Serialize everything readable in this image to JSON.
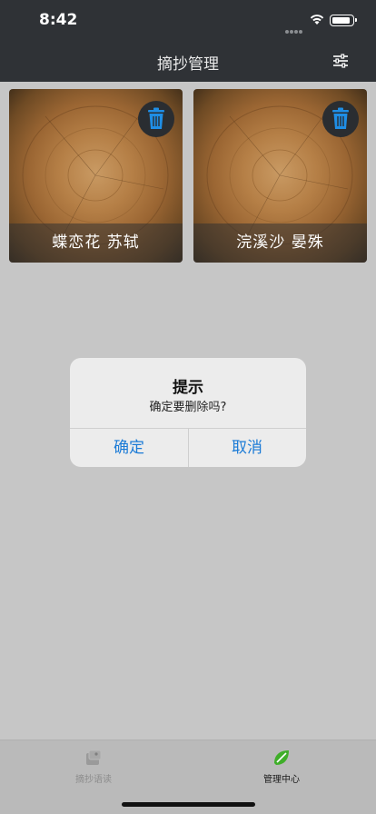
{
  "status_bar": {
    "time": "8:42"
  },
  "nav": {
    "title": "摘抄管理"
  },
  "cards": [
    {
      "caption": "蝶恋花  苏轼"
    },
    {
      "caption": "浣溪沙 晏殊"
    }
  ],
  "dialog": {
    "title": "提示",
    "message": "确定要删除吗?",
    "ok_label": "确定",
    "cancel_label": "取消"
  },
  "tabs": [
    {
      "label": "摘抄语读",
      "icon": "read-icon",
      "active": false
    },
    {
      "label": "管理中心",
      "icon": "leaf-icon",
      "active": true
    }
  ],
  "colors": {
    "nav_background": "#2f3236",
    "accent_blue": "#1a7ad6",
    "active_tab_green": "#3fae29",
    "overlay_background": "#c6c6c6"
  }
}
